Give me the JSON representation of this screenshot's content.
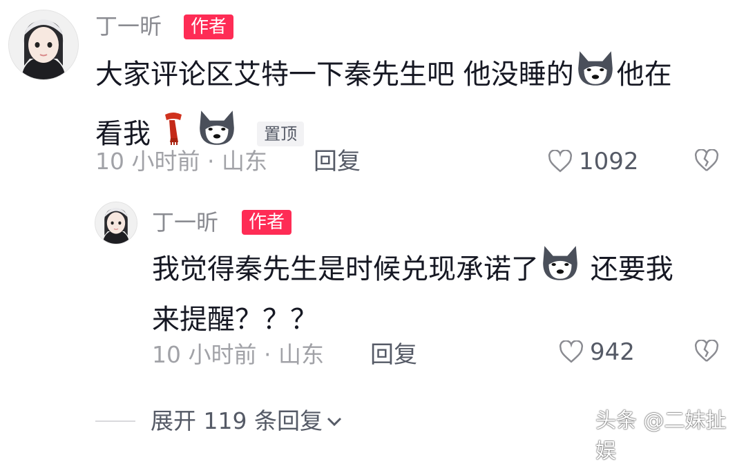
{
  "comment": {
    "author": "丁一昕",
    "badge": "作者",
    "text_line1": "大家评论区艾特一下秦先生吧 他没睡的",
    "text_line1_tail": "他在",
    "text_line2": "看我",
    "pinned_label": "置顶",
    "meta": "10 小时前 · 山东",
    "reply_label": "回复",
    "likes": "1092"
  },
  "reply": {
    "author": "丁一昕",
    "badge": "作者",
    "text_line1": "我觉得秦先生是时候兑现承诺了",
    "text_line1_tail": "还要我",
    "text_line2": "来提醒？？？",
    "meta": "10 小时前 · 山东",
    "reply_label": "回复",
    "likes": "942"
  },
  "expand": {
    "label": "展开 119 条回复"
  },
  "watermark": {
    "text": "头条 @二妹扯娱"
  },
  "colors": {
    "badge": "#fe2c55",
    "meta": "#a1a2a7",
    "text": "#161823"
  }
}
